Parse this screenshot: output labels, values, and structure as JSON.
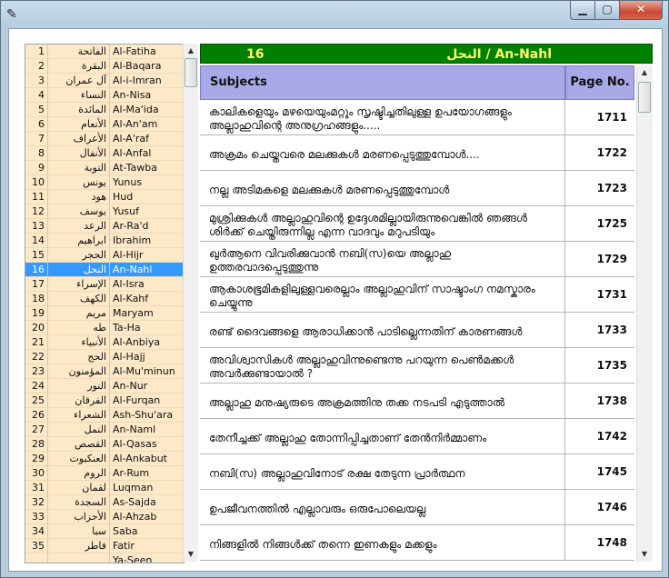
{
  "window": {
    "close_label": "✕",
    "min_label": "▁",
    "max_label": "▢"
  },
  "chapter": {
    "number": "16",
    "name": "النحل / An-Nahl"
  },
  "surahs": [
    {
      "n": "1",
      "ar": "الفاتحة",
      "en": "Al-Fatiha"
    },
    {
      "n": "2",
      "ar": "البقرة",
      "en": "Al-Baqara"
    },
    {
      "n": "3",
      "ar": "آل عمران",
      "en": "Al-i-Imran"
    },
    {
      "n": "4",
      "ar": "النساء",
      "en": "An-Nisa"
    },
    {
      "n": "5",
      "ar": "المائدة",
      "en": "Al-Ma'ida"
    },
    {
      "n": "6",
      "ar": "الأنعام",
      "en": "Al-An'am"
    },
    {
      "n": "7",
      "ar": "الأعراف",
      "en": "Al-A'raf"
    },
    {
      "n": "8",
      "ar": "الأنفال",
      "en": "Al-Anfal"
    },
    {
      "n": "9",
      "ar": "التوبة",
      "en": "At-Tawba"
    },
    {
      "n": "10",
      "ar": "يونس",
      "en": "Yunus"
    },
    {
      "n": "11",
      "ar": "هود",
      "en": "Hud"
    },
    {
      "n": "12",
      "ar": "يوسف",
      "en": "Yusuf"
    },
    {
      "n": "13",
      "ar": "الرعد",
      "en": "Ar-Ra'd"
    },
    {
      "n": "14",
      "ar": "ابراهيم",
      "en": "Ibrahim"
    },
    {
      "n": "15",
      "ar": "الحجر",
      "en": "Al-Hijr"
    },
    {
      "n": "16",
      "ar": "النحل",
      "en": "An-Nahl"
    },
    {
      "n": "17",
      "ar": "الإسراء",
      "en": "Al-Isra"
    },
    {
      "n": "18",
      "ar": "الكهف",
      "en": "Al-Kahf"
    },
    {
      "n": "19",
      "ar": "مريم",
      "en": "Maryam"
    },
    {
      "n": "20",
      "ar": "طه",
      "en": "Ta-Ha"
    },
    {
      "n": "21",
      "ar": "الأنبياء",
      "en": "Al-Anbiya"
    },
    {
      "n": "22",
      "ar": "الحج",
      "en": "Al-Hajj"
    },
    {
      "n": "23",
      "ar": "المؤمنون",
      "en": "Al-Mu'minun"
    },
    {
      "n": "24",
      "ar": "النور",
      "en": "An-Nur"
    },
    {
      "n": "25",
      "ar": "الفرقان",
      "en": "Al-Furqan"
    },
    {
      "n": "26",
      "ar": "الشعراء",
      "en": "Ash-Shu'ara"
    },
    {
      "n": "27",
      "ar": "النمل",
      "en": "An-Naml"
    },
    {
      "n": "28",
      "ar": "القصص",
      "en": "Al-Qasas"
    },
    {
      "n": "29",
      "ar": "العنكبوت",
      "en": "Al-Ankabut"
    },
    {
      "n": "30",
      "ar": "الروم",
      "en": "Ar-Rum"
    },
    {
      "n": "31",
      "ar": "لقمان",
      "en": "Luqman"
    },
    {
      "n": "32",
      "ar": "السجدة",
      "en": "As-Sajda"
    },
    {
      "n": "33",
      "ar": "الأحزاب",
      "en": "Al-Ahzab"
    },
    {
      "n": "34",
      "ar": "سبا",
      "en": "Saba"
    },
    {
      "n": "35",
      "ar": "فاطر",
      "en": "Fatir"
    },
    {
      "n": "",
      "ar": "",
      "en": "Ya-Seen"
    }
  ],
  "selected_surah": 16,
  "table": {
    "col_subject": "Subjects",
    "col_page": "Page No.",
    "rows": [
      {
        "subject": "കാലികളെയും മഴയെയുംമറ്റും സൃഷ്ടിച്ചതിലുള്ള ഉപയോഗങ്ങളും അല്ലാഹുവിന്റെ അനുഗ്രഹങ്ങളും.....",
        "page": "1711"
      },
      {
        "subject": "അക്രമം ചെയ്തവരെ മലക്കുകൾ മരണപ്പെടുത്തുമ്പോൾ....",
        "page": "1722"
      },
      {
        "subject": "നല്ല അടിമകളെ മലക്കുകൾ മരണപ്പെടുത്തുമ്പോൾ",
        "page": "1723"
      },
      {
        "subject": "മുശ്രിക്കുകൾ അല്ലാഹുവിന്റെ ഉദ്ദേശമില്ലായിരുന്നുവെങ്കിൽ ഞങ്ങൾ ശിർക്ക് ചെയ്തിരുന്നില്ല എന്ന വാദവും മറുപടിയും",
        "page": "1725"
      },
      {
        "subject": "ഖുർആനെ വിവരിക്കുവാൻ നബി(സ)യെ അല്ലാഹു ഉത്തരവാദപ്പെടുത്തുന്നു",
        "page": "1729"
      },
      {
        "subject": "ആകാശഭൂമികളിലുള്ളവരെല്ലാം അല്ലാഹുവിന് സാഷ്ടാംഗ നമസ്കാരം ചെയ്യുന്നു",
        "page": "1731"
      },
      {
        "subject": "രണ്ട് ദൈവങ്ങളെ ആരാധിക്കാൻ പാടില്ലെന്നതിന് കാരണങ്ങൾ",
        "page": "1733"
      },
      {
        "subject": "അവിശ്വാസികൾ അല്ലാഹുവിന്നുണ്ടെന്നു പറയുന്ന പെൺമക്കൾ അവർക്കുണ്ടായാൽ ?",
        "page": "1735"
      },
      {
        "subject": "അല്ലാഹു മനുഷ്യരുടെ അക്രമത്തിനു തക്ക നടപടി എടുത്താൽ",
        "page": "1738"
      },
      {
        "subject": "തേനീച്ചക്ക് അല്ലാഹു തോന്നിപ്പിച്ചതാണ് തേൻനിർമ്മാണം",
        "page": "1742"
      },
      {
        "subject": "നബി(സ) അല്ലാഹുവിനോട് രക്ഷ തേടുന്ന പ്രാർത്ഥന",
        "page": "1745"
      },
      {
        "subject": "ഉപജീവനത്തിൽ എല്ലാവരും ഒരുപോലെയല്ല",
        "page": "1746"
      },
      {
        "subject": "നിങ്ങളിൽ നിങ്ങൾക്ക് തന്നെ ഇണകളും മക്കളും",
        "page": "1748"
      }
    ]
  }
}
